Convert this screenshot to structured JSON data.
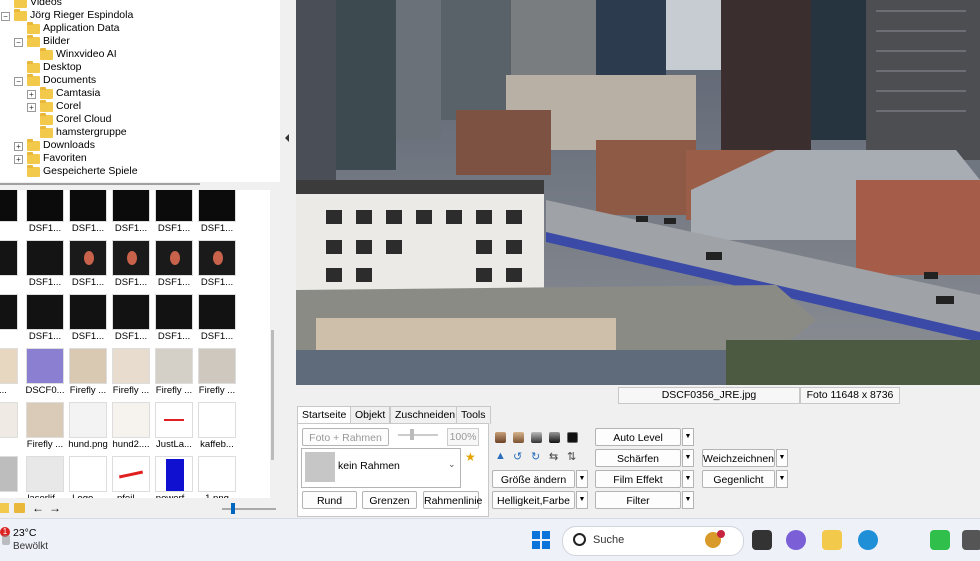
{
  "tree": {
    "items": [
      {
        "label": "Videos",
        "indent": 0,
        "expander": ""
      },
      {
        "label": "Jörg Rieger Espindola",
        "indent": 0,
        "expander": "−"
      },
      {
        "label": "Application Data",
        "indent": 1,
        "expander": ""
      },
      {
        "label": "Bilder",
        "indent": 1,
        "expander": "−"
      },
      {
        "label": "Winxvideo AI",
        "indent": 2,
        "expander": ""
      },
      {
        "label": "Desktop",
        "indent": 1,
        "expander": ""
      },
      {
        "label": "Documents",
        "indent": 1,
        "expander": "−"
      },
      {
        "label": "Camtasia",
        "indent": 2,
        "expander": "+"
      },
      {
        "label": "Corel",
        "indent": 2,
        "expander": "+"
      },
      {
        "label": "Corel Cloud",
        "indent": 2,
        "expander": ""
      },
      {
        "label": "hamstergruppe",
        "indent": 2,
        "expander": ""
      },
      {
        "label": "Downloads",
        "indent": 1,
        "expander": "+"
      },
      {
        "label": "Favoriten",
        "indent": 1,
        "expander": "+"
      },
      {
        "label": "Gespeicherte Spiele",
        "indent": 1,
        "expander": ""
      }
    ]
  },
  "thumbs": {
    "rows": [
      [
        "",
        "DSF1...",
        "DSF1...",
        "DSF1...",
        "DSF1...",
        "DSF1..."
      ],
      [
        "",
        "DSF1...",
        "DSF1...",
        "DSF1...",
        "DSF1...",
        "DSF1..."
      ],
      [
        "",
        "DSF1...",
        "DSF1...",
        "DSF1...",
        "DSF1...",
        "DSF1..."
      ],
      [
        "ta...",
        "DSCF0...",
        "Firefly ...",
        "Firefly ...",
        "Firefly ...",
        "Firefly ..."
      ],
      [
        "",
        "Firefly ...",
        "hund.png",
        "hund2....",
        "JustLa...",
        "kaffeb..."
      ],
      [
        "lif...",
        "laserlif...",
        "Logo ...",
        "pfeil ...",
        "powerf...",
        "1.png"
      ]
    ]
  },
  "status": {
    "filename": "DSCF0356_JRE.jpg",
    "dimensions": "Foto 11648 x 8736"
  },
  "ribbon": {
    "tabs": [
      "Startseite",
      "Objekt",
      "Zuschneiden",
      "Tools"
    ],
    "foto_rahmen": "Foto + Rahmen",
    "zoom": "100%",
    "frame_select": "kein Rahmen",
    "rund": "Rund",
    "grenzen": "Grenzen",
    "rahmenlinie": "Rahmenlinie",
    "groesse": "Größe ändern",
    "helligkeit": "Helligkeit,Farbe",
    "auto_level": "Auto Level",
    "schaerfen": "Schärfen",
    "film_effekt": "Film Effekt",
    "filter": "Filter",
    "weichzeichnen": "Weichzeichnen",
    "gegenlicht": "Gegenlicht"
  },
  "taskbar": {
    "weather_temp": "23°C",
    "weather_desc": "Bewölkt",
    "badge": "1",
    "search_placeholder": "Suche"
  },
  "colors": {
    "accent": "#0067c0",
    "folder": "#f3c94b"
  }
}
